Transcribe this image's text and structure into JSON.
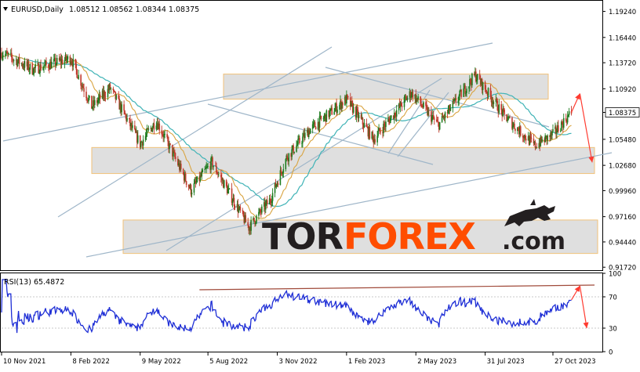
{
  "header": {
    "symbol": "EURUSD,Daily",
    "ohlc": "1.08512 1.08562 1.08344 1.08375",
    "dropdown_icon": "triangle-down-icon"
  },
  "watermark": {
    "brand_tor": "TOR",
    "brand_forex": "FOREX",
    "brand_suffix": ".com",
    "brand_color_dark": "#231f20",
    "brand_color_accent": "#ff4d00",
    "logo_icon": "bull-icon"
  },
  "chart_data": [
    {
      "type": "candlestick",
      "symbol": "EURUSD",
      "timeframe": "Daily",
      "price_axis_ticks": [
        "1.19240",
        "1.16440",
        "1.13720",
        "1.10920",
        "1.08375",
        "1.05480",
        "1.02680",
        "0.99960",
        "0.97160",
        "0.94440",
        "0.91720"
      ],
      "price_axis_values": [
        1.1924,
        1.1644,
        1.1372,
        1.1092,
        1.08375,
        1.0548,
        1.0268,
        0.9996,
        0.9716,
        0.9444,
        0.9172
      ],
      "current_price_label": "1.08375",
      "ylim": [
        0.914,
        1.203
      ],
      "x_axis_labels": [
        "10 Nov 2021",
        "8 Feb 2022",
        "9 May 2022",
        "5 Aug 2022",
        "3 Nov 2022",
        "1 Feb 2023",
        "2 May 2023",
        "31 Jul 2023",
        "27 Oct 2023"
      ],
      "price_path_anchors": [
        {
          "date": "2021-11-10",
          "close": 1.148
        },
        {
          "date": "2021-12-20",
          "close": 1.13
        },
        {
          "date": "2022-02-08",
          "close": 1.142
        },
        {
          "date": "2022-03-07",
          "close": 1.09
        },
        {
          "date": "2022-03-31",
          "close": 1.11
        },
        {
          "date": "2022-05-09",
          "close": 1.05
        },
        {
          "date": "2022-05-30",
          "close": 1.075
        },
        {
          "date": "2022-07-14",
          "close": 1.0
        },
        {
          "date": "2022-08-10",
          "close": 1.03
        },
        {
          "date": "2022-09-27",
          "close": 0.96
        },
        {
          "date": "2022-10-25",
          "close": 0.99
        },
        {
          "date": "2022-11-15",
          "close": 1.035
        },
        {
          "date": "2022-12-15",
          "close": 1.065
        },
        {
          "date": "2023-02-01",
          "close": 1.098
        },
        {
          "date": "2023-03-08",
          "close": 1.055
        },
        {
          "date": "2023-04-26",
          "close": 1.105
        },
        {
          "date": "2023-05-31",
          "close": 1.07
        },
        {
          "date": "2023-07-18",
          "close": 1.124
        },
        {
          "date": "2023-08-25",
          "close": 1.08
        },
        {
          "date": "2023-10-03",
          "close": 1.048
        },
        {
          "date": "2023-10-27",
          "close": 1.06
        },
        {
          "date": "2023-11-20",
          "close": 1.0838
        }
      ],
      "moving_averages": [
        {
          "color": "#d9a441",
          "role": "fast MA"
        },
        {
          "color": "#3fb3b6",
          "role": "slow MA"
        }
      ],
      "support_resistance_zones": [
        {
          "from": 1.098,
          "to": 1.125,
          "style": "resistance"
        },
        {
          "from": 1.018,
          "to": 1.046,
          "style": "support"
        },
        {
          "from": 0.932,
          "to": 0.968,
          "style": "support"
        }
      ],
      "forecast_arrows": [
        {
          "from_date": "2023-11-20",
          "from": 1.0838,
          "to_date": "2023-12-01",
          "to": 1.104,
          "color": "#ff3b30"
        },
        {
          "from_date": "2023-12-01",
          "from": 1.104,
          "to_date": "2023-12-17",
          "to": 1.03,
          "color": "#ff3b30"
        }
      ],
      "colors": {
        "bull_candle": "#1e7b1e",
        "bear_candle": "#c0392b",
        "trendlines": "#9fb6c9"
      }
    },
    {
      "type": "line",
      "name": "RSI(13)",
      "title": "RSI(13) 65.4872",
      "ylim": [
        0,
        100
      ],
      "y_ticks": [
        100,
        70,
        30,
        0
      ],
      "level_lines": [
        70,
        30
      ],
      "last_value": 65.4872,
      "line_color": "#1f2fd6",
      "trend_line": {
        "from_date": "2022-07-25",
        "from": 79,
        "to_date": "2023-12-20",
        "to": 85,
        "color": "#a04a3a"
      },
      "forecast_arrows": [
        {
          "from_date": "2023-11-20",
          "from": 66,
          "to_date": "2023-12-01",
          "to": 84,
          "color": "#ff3b30"
        },
        {
          "from_date": "2023-12-01",
          "from": 84,
          "to_date": "2023-12-10",
          "to": 30,
          "color": "#ff3b30"
        }
      ]
    }
  ]
}
